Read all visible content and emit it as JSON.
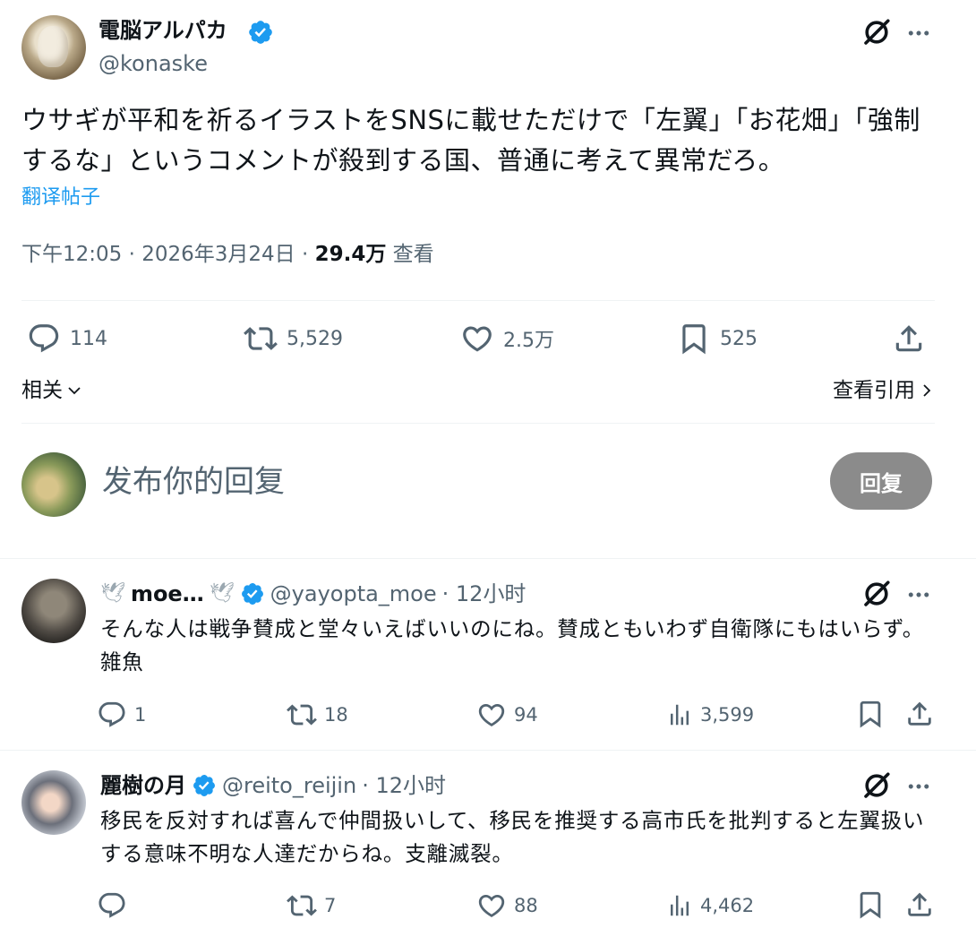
{
  "tweet": {
    "author_name": "電脳アルパカ",
    "author_handle": "@konaske",
    "text": "ウサギが平和を祈るイラストをSNSに載せただけで「左翼」「お花畑」「強制するな」というコメントが殺到する国、普通に考えて異常だろ。",
    "translate_label": "翻译帖子",
    "time": "下午12:05 · 2026年3月24日 · ",
    "views_count": "29.4万",
    "views_label": " 查看",
    "stats": {
      "replies": "114",
      "retweets": "5,529",
      "likes": "2.5万",
      "bookmarks": "525"
    },
    "related_label": "相关",
    "quotes_label": "查看引用"
  },
  "composer": {
    "placeholder": "发布你的回复",
    "reply_button": "回复"
  },
  "replies": [
    {
      "name": "moe…",
      "handle": "@yayopta_moe",
      "time": "· 12小时",
      "text": "そんな人は戦争賛成と堂々いえばいいのにね。賛成ともいわず自衛隊にもはいらず。雑魚",
      "stats": {
        "replies": "1",
        "retweets": "18",
        "likes": "94",
        "views": "3,599"
      }
    },
    {
      "name": "麗樹の月",
      "handle": "@reito_reijin",
      "time": "· 12小时",
      "text": "移民を反対すれば喜んで仲間扱いして、移民を推奨する高市氏を批判すると左翼扱いする意味不明な人達だからね。支離滅裂。",
      "stats": {
        "replies": "",
        "retweets": "7",
        "likes": "88",
        "views": "4,462"
      }
    }
  ],
  "colors": {
    "text": "#0f1419",
    "muted": "#536471",
    "link": "#1d9bf0",
    "verified": "#1d9bf0",
    "reply_button_bg": "#8b8b8b",
    "separator": "#eff3f4"
  }
}
